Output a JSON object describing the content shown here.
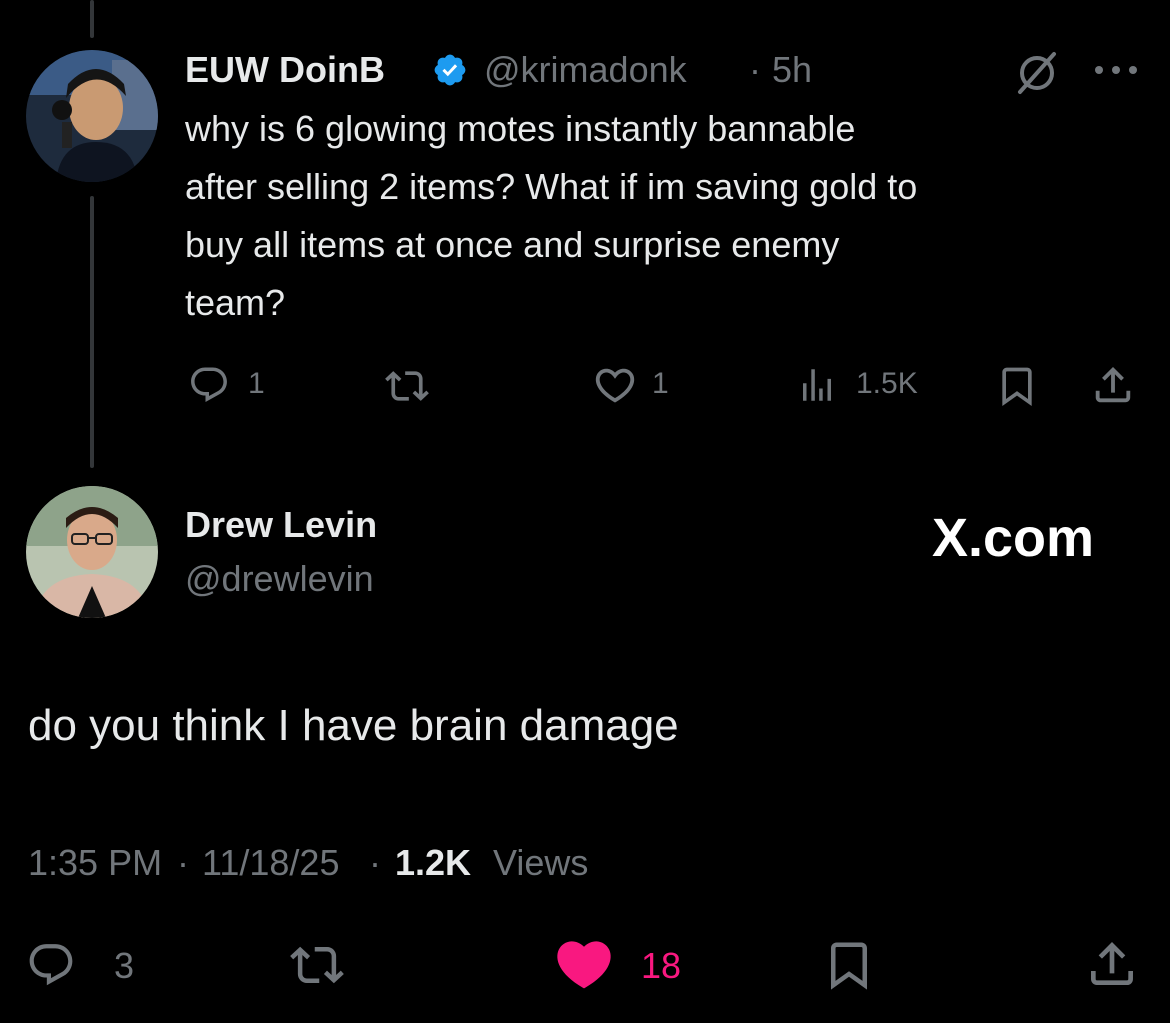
{
  "parent_tweet": {
    "author_name": "EUW DoinB",
    "handle": "@krimadonk",
    "separator": "·",
    "time_ago": "5h",
    "text_lines": [
      "why is 6 glowing motes instantly bannable",
      "after selling 2 items? What if im saving gold to",
      "buy all items at once and surprise enemy",
      "team?"
    ],
    "actions": {
      "reply_count": "1",
      "retweet_count": "",
      "like_count": "1",
      "views": "1.5K"
    }
  },
  "reply_tweet": {
    "author_name": "Drew Levin",
    "handle": "@drewlevin",
    "source_label": "X.com",
    "text": "do you think I have brain damage",
    "meta": {
      "time": "1:35 PM",
      "sep1": "·",
      "date": "11/18/25",
      "sep2": "·",
      "views_count": "1.2K",
      "views_label": "Views"
    },
    "actions": {
      "reply_count": "3",
      "like_count": "18"
    }
  },
  "colors": {
    "background": "#000000",
    "text": "#e7e9ea",
    "secondary": "#71767b",
    "verified": "#1d9bf0",
    "like": "#f91880"
  },
  "icons": [
    "verified-badge-icon",
    "grok-icon",
    "more-icon",
    "reply-icon",
    "retweet-icon",
    "like-icon",
    "views-icon",
    "bookmark-icon",
    "share-icon"
  ]
}
